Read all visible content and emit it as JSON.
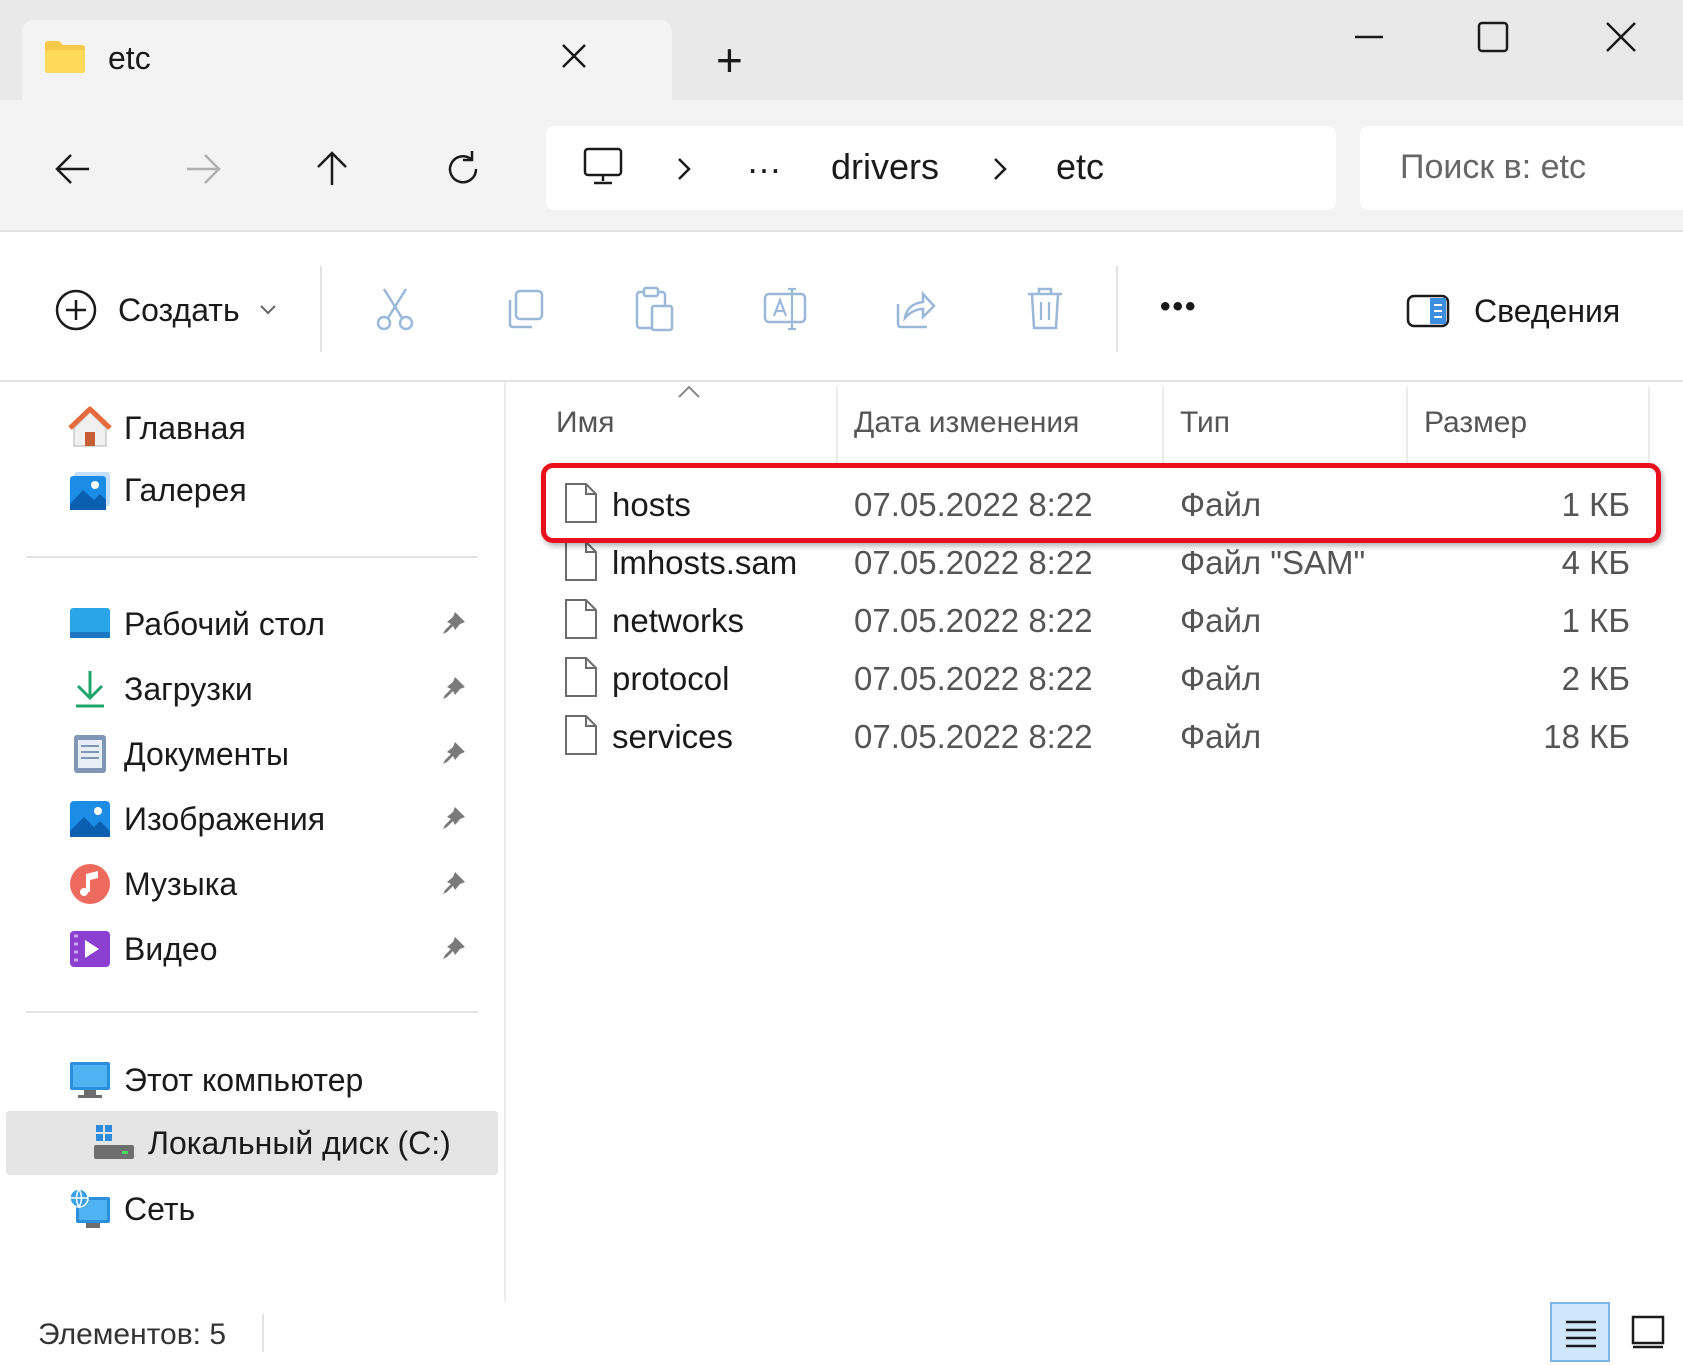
{
  "window": {
    "tab_title": "etc",
    "new_tab_symbol": "+"
  },
  "nav": {
    "breadcrumb": [
      "…",
      "drivers",
      "etc"
    ],
    "search_placeholder": "Поиск в: etc"
  },
  "toolbar": {
    "create_label": "Создать",
    "details_label": "Сведения",
    "more_symbol": "•••"
  },
  "sidebar": {
    "quick": [
      {
        "label": "Главная",
        "icon": "home-icon"
      },
      {
        "label": "Галерея",
        "icon": "gallery-icon"
      }
    ],
    "pinned": [
      {
        "label": "Рабочий стол",
        "icon": "desktop-icon"
      },
      {
        "label": "Загрузки",
        "icon": "downloads-icon"
      },
      {
        "label": "Документы",
        "icon": "documents-icon"
      },
      {
        "label": "Изображения",
        "icon": "pictures-icon"
      },
      {
        "label": "Музыка",
        "icon": "music-icon"
      },
      {
        "label": "Видео",
        "icon": "videos-icon"
      }
    ],
    "this_pc": "Этот компьютер",
    "local_disk": "Локальный диск (C:)",
    "network": "Сеть"
  },
  "file_list": {
    "columns": [
      "Имя",
      "Дата изменения",
      "Тип",
      "Размер"
    ],
    "rows": [
      {
        "name": "hosts",
        "date": "07.05.2022 8:22",
        "type": "Файл",
        "size": "1 КБ",
        "highlighted": true
      },
      {
        "name": "lmhosts.sam",
        "date": "07.05.2022 8:22",
        "type": "Файл \"SAM\"",
        "size": "4 КБ"
      },
      {
        "name": "networks",
        "date": "07.05.2022 8:22",
        "type": "Файл",
        "size": "1 КБ"
      },
      {
        "name": "protocol",
        "date": "07.05.2022 8:22",
        "type": "Файл",
        "size": "2 КБ"
      },
      {
        "name": "services",
        "date": "07.05.2022 8:22",
        "type": "Файл",
        "size": "18 КБ"
      }
    ],
    "highlight_color": "#e8101c"
  },
  "status": {
    "items_count": "Элементов: 5"
  }
}
